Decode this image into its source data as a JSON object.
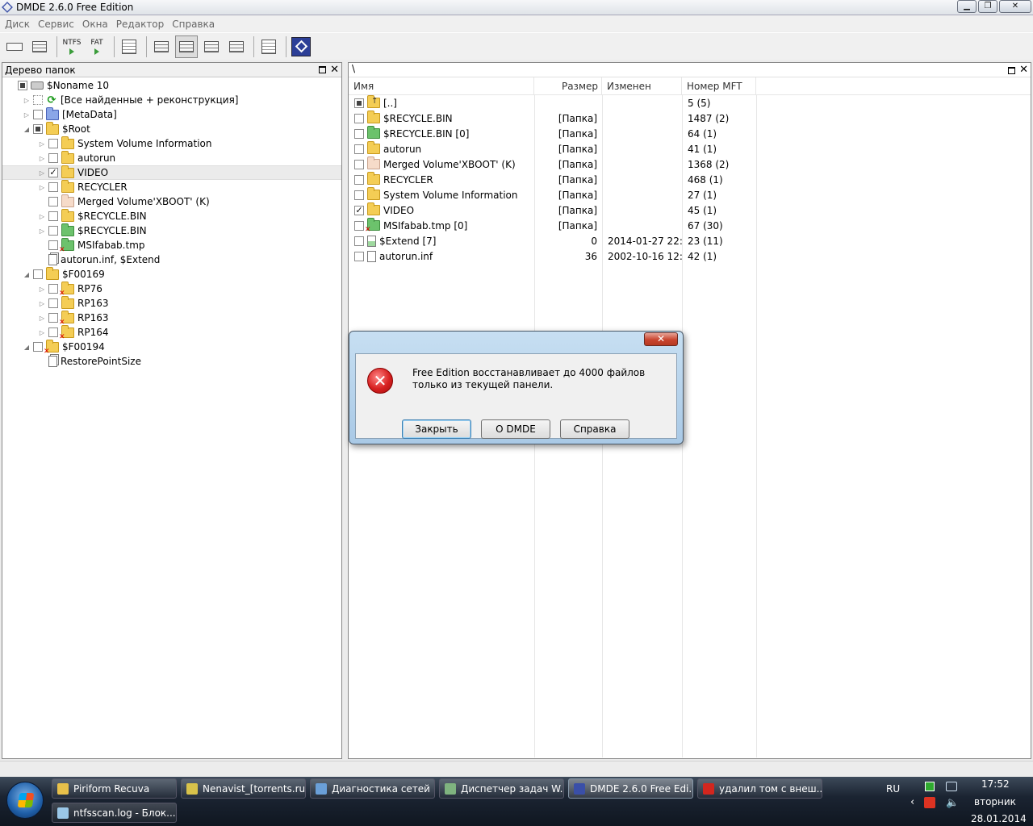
{
  "window": {
    "title": "DMDE 2.6.0 Free Edition"
  },
  "menu": [
    "Диск",
    "Сервис",
    "Окна",
    "Редактор",
    "Справка"
  ],
  "toolbar": {
    "ntfs_label": "NTFS",
    "fat_label": "FAT"
  },
  "left_panel": {
    "title": "Дерево папок",
    "tree": [
      {
        "label": "$Noname 10",
        "depth": 0,
        "expander": "",
        "check": "partial",
        "icon": "drive"
      },
      {
        "label": "[Все найденные + реконструкция]",
        "depth": 1,
        "expander": "▷",
        "check": "dotted",
        "icon": "refresh"
      },
      {
        "label": "[MetaData]",
        "depth": 1,
        "expander": "▷",
        "check": "none",
        "icon": "folder-blue"
      },
      {
        "label": "$Root",
        "depth": 1,
        "expander": "◢",
        "check": "partial",
        "icon": "folder"
      },
      {
        "label": "System Volume Information",
        "depth": 2,
        "expander": "▷",
        "check": "none",
        "icon": "folder"
      },
      {
        "label": "autorun",
        "depth": 2,
        "expander": "▷",
        "check": "none",
        "icon": "folder"
      },
      {
        "label": "VIDEO",
        "depth": 2,
        "expander": "▷",
        "check": "checked",
        "icon": "folder",
        "selected": true
      },
      {
        "label": "RECYCLER",
        "depth": 2,
        "expander": "▷",
        "check": "none",
        "icon": "folder"
      },
      {
        "label": "Merged Volume'XBOOT' (K)",
        "depth": 2,
        "expander": "",
        "check": "none",
        "icon": "folder-pink"
      },
      {
        "label": "$RECYCLE.BIN",
        "depth": 2,
        "expander": "▷",
        "check": "none",
        "icon": "folder"
      },
      {
        "label": "$RECYCLE.BIN",
        "depth": 2,
        "expander": "▷",
        "check": "none",
        "icon": "folder-green"
      },
      {
        "label": "MSIfabab.tmp",
        "depth": 2,
        "expander": "",
        "check": "none",
        "icon": "folder-green-del"
      },
      {
        "label": "autorun.inf, $Extend",
        "depth": 2,
        "expander": "",
        "check": "",
        "icon": "file-multi"
      },
      {
        "label": "$F00169",
        "depth": 1,
        "expander": "◢",
        "check": "none",
        "icon": "folder"
      },
      {
        "label": "RP76",
        "depth": 2,
        "expander": "▷",
        "check": "none",
        "icon": "folder-del"
      },
      {
        "label": "RP163",
        "depth": 2,
        "expander": "▷",
        "check": "none",
        "icon": "folder"
      },
      {
        "label": "RP163",
        "depth": 2,
        "expander": "▷",
        "check": "none",
        "icon": "folder-del"
      },
      {
        "label": "RP164",
        "depth": 2,
        "expander": "▷",
        "check": "none",
        "icon": "folder-del"
      },
      {
        "label": "$F00194",
        "depth": 1,
        "expander": "◢",
        "check": "none",
        "icon": "folder-del"
      },
      {
        "label": "RestorePointSize",
        "depth": 2,
        "expander": "",
        "check": "",
        "icon": "file-multi"
      }
    ]
  },
  "right_panel": {
    "path": "\\",
    "columns": [
      "Имя",
      "Размер",
      "Изменен",
      "Номер MFT"
    ],
    "rows": [
      {
        "name": "[..]",
        "size": "",
        "date": "",
        "mft": "5 (5)",
        "check": "partial",
        "icon": "folder-up"
      },
      {
        "name": "$RECYCLE.BIN",
        "size": "[Папка]",
        "date": "",
        "mft": "1487 (2)",
        "check": "none",
        "icon": "folder"
      },
      {
        "name": "$RECYCLE.BIN [0]",
        "size": "[Папка]",
        "date": "",
        "mft": "64 (1)",
        "check": "none",
        "icon": "folder-green"
      },
      {
        "name": "autorun",
        "size": "[Папка]",
        "date": "",
        "mft": "41 (1)",
        "check": "none",
        "icon": "folder"
      },
      {
        "name": "Merged Volume'XBOOT' (K)",
        "size": "[Папка]",
        "date": "",
        "mft": "1368 (2)",
        "check": "none",
        "icon": "folder-pink"
      },
      {
        "name": "RECYCLER",
        "size": "[Папка]",
        "date": "",
        "mft": "468 (1)",
        "check": "none",
        "icon": "folder"
      },
      {
        "name": "System Volume Information",
        "size": "[Папка]",
        "date": "",
        "mft": "27 (1)",
        "check": "none",
        "icon": "folder"
      },
      {
        "name": "VIDEO",
        "size": "[Папка]",
        "date": "",
        "mft": "45 (1)",
        "check": "checked",
        "icon": "folder"
      },
      {
        "name": "MSIfabab.tmp [0]",
        "size": "[Папка]",
        "date": "",
        "mft": "67 (30)",
        "check": "none",
        "icon": "folder-green-del"
      },
      {
        "name": "$Extend [7]",
        "size": "0",
        "date": "2014-01-27 22:...",
        "mft": "23 (11)",
        "check": "none",
        "icon": "file-green"
      },
      {
        "name": "autorun.inf",
        "size": "36",
        "date": "2002-10-16 12:...",
        "mft": "42 (1)",
        "check": "none",
        "icon": "file"
      }
    ]
  },
  "dialog": {
    "close_glyph": "✕",
    "message": "Free Edition восстанавливает до 4000 файлов только из текущей панели.",
    "buttons": {
      "close": "Закрыть",
      "about": "О DMDE",
      "help": "Справка"
    }
  },
  "taskbar": {
    "tasks": [
      {
        "label": "Piriform Recuva",
        "color": "#e8c04a"
      },
      {
        "label": "Nenavist_[torrents.ru]",
        "color": "#d9c24a"
      },
      {
        "label": "Диагностика сетей ...",
        "color": "#6a9fd8"
      },
      {
        "label": "Диспетчер задач W...",
        "color": "#7fb37f"
      },
      {
        "label": "DMDE 2.6.0 Free Edi...",
        "color": "#3a4fa8",
        "active": true
      },
      {
        "label": "удалил том с внеш...",
        "color": "#d2261e"
      },
      {
        "label": "ntfsscan.log - Блок...",
        "color": "#9ac7e8"
      }
    ],
    "lang": "RU",
    "time": "17:52",
    "weekday": "вторник",
    "date": "28.01.2014"
  },
  "colors": {
    "accent": "#3a4fa8",
    "error": "#d72020",
    "taskbar": "#1b2432"
  }
}
